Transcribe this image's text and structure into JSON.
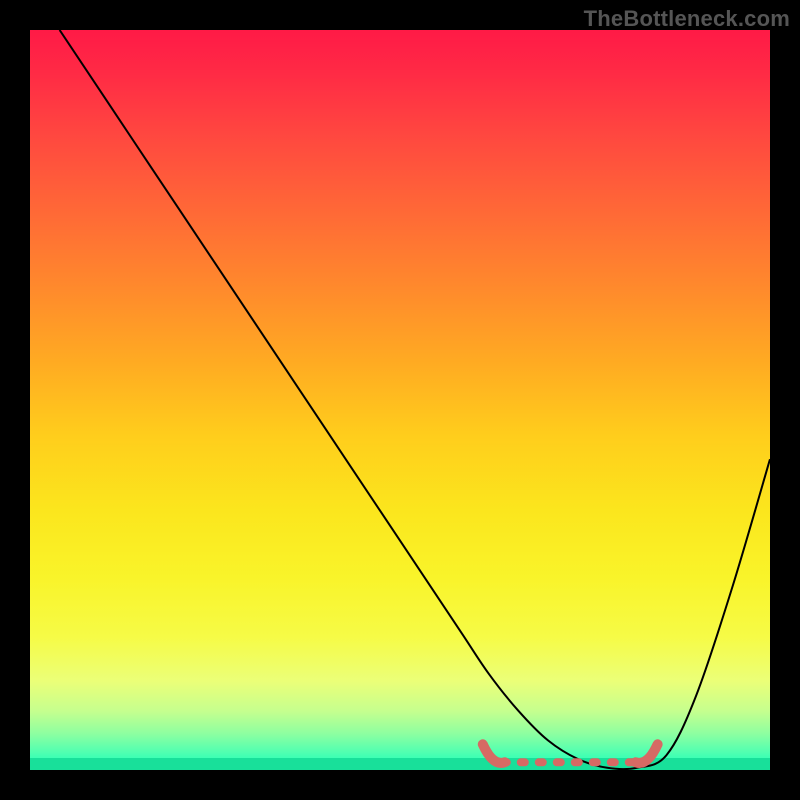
{
  "watermark": "TheBottleneck.com",
  "colors": {
    "frame": "#000000",
    "curve": "#000000",
    "minimum_marker": "#d66a64",
    "gradient_top": "#ff1a46",
    "gradient_bottom": "#18ffba"
  },
  "chart_data": {
    "type": "line",
    "title": "",
    "xlabel": "",
    "ylabel": "",
    "xlim": [
      0,
      100
    ],
    "ylim": [
      0,
      100
    ],
    "x": [
      4,
      10,
      20,
      30,
      40,
      50,
      58,
      62,
      66,
      70,
      74,
      78,
      82,
      86,
      90,
      95,
      100
    ],
    "values": [
      100,
      91,
      76,
      61,
      46,
      31,
      19,
      13,
      8,
      4,
      1.5,
      0.3,
      0.3,
      2,
      10,
      25,
      42
    ],
    "minimum_region": {
      "x_start": 62,
      "x_end": 84,
      "y": 0.5
    }
  }
}
